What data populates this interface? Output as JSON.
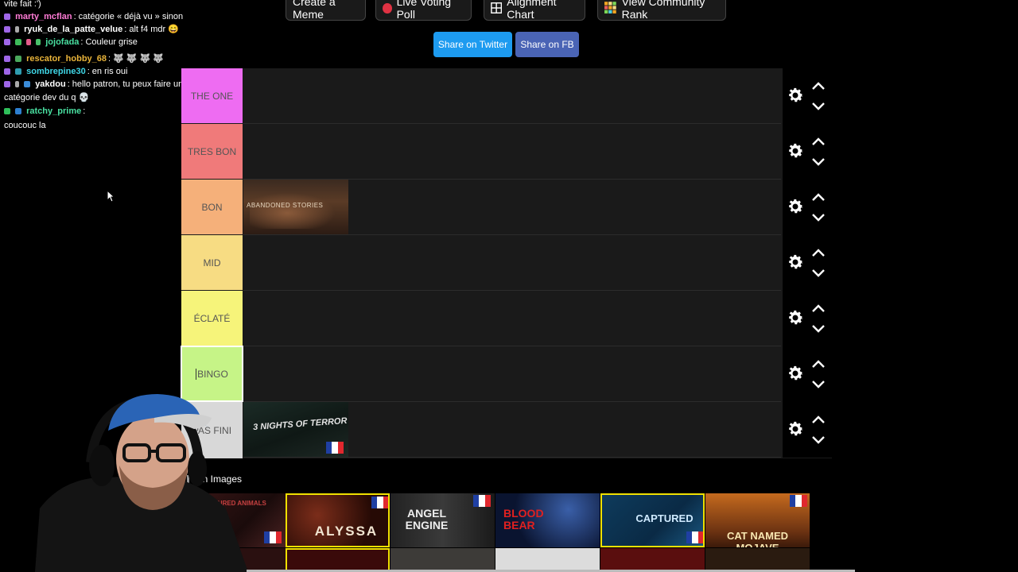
{
  "chat": {
    "messages": [
      {
        "user": "",
        "text": "vite fait :')",
        "user_color": "#ffffff"
      },
      {
        "user": "marty_mcflan",
        "text": "catégorie « déjà vu » sinon",
        "user_color": "#ff7bd6"
      },
      {
        "user": "ryuk_de_la_patte_velue",
        "text": "alt f4 mdr 😄",
        "user_color": "#ffffff"
      },
      {
        "user": "jojofada",
        "text": "Couleur grise",
        "user_color": "#49e0a1"
      },
      {
        "user": "rescator_hobby_68",
        "text": "🐺 🐺 🐺 🐺",
        "user_color": "#e9b43a"
      },
      {
        "user": "sombrepine30",
        "text": "en ris oui",
        "user_color": "#3fd6e6"
      },
      {
        "user": "yakdou",
        "text": "hello patron, tu peux faire une",
        "user_color": "#ffffff"
      },
      {
        "user": "",
        "text": "catégorie dev du q 💀",
        "user_color": "#ffffff"
      },
      {
        "user": "ratchy_prime",
        "text": "",
        "user_color": "#49e0a1"
      },
      {
        "user": "",
        "text": "coucouc la",
        "user_color": "#ffffff"
      }
    ]
  },
  "toolbar": {
    "create_meme": "Create a Meme",
    "live_voting": "Live Voting Poll",
    "alignment_chart": "Alignment Chart",
    "community_rank": "View Community Rank"
  },
  "share": {
    "twitter": "Share on Twitter",
    "facebook": "Share on FB",
    "twitter_color": "#1d9bf0",
    "facebook_color": "#4a64b5"
  },
  "tiers": [
    {
      "label": "THE ONE",
      "color": "#ee6cf2"
    },
    {
      "label": "TRES BON",
      "color": "#f07a7a"
    },
    {
      "label": "BON",
      "color": "#f5b07a"
    },
    {
      "label": "MID",
      "color": "#f7dc83"
    },
    {
      "label": "ÉCLATÉ",
      "color": "#f6f47a"
    },
    {
      "label": "BINGO",
      "color": "#c6f487"
    },
    {
      "label": "PAS FINI",
      "color": "#d8d8d8"
    }
  ],
  "tier_items": {
    "bon_item": "ABANDONED STORIES",
    "pas_fini_item": "3 NIGHTS OF TERROR"
  },
  "pin": {
    "label": "Pin Images"
  },
  "pool": [
    {
      "title": "TORTURED ANIMALS"
    },
    {
      "title": "ALYSSA"
    },
    {
      "title": "ANGEL ENGINE"
    },
    {
      "title": "BLOOD BEAR"
    },
    {
      "title": "CAPTURED"
    },
    {
      "title": "CAT NAMED MOJAVE"
    }
  ],
  "icons": {
    "gear": "gear-icon",
    "up": "chevron-up-icon",
    "down": "chevron-down-icon",
    "grid": "grid-icon",
    "rank": "rank-grid-icon",
    "record": "record-dot-icon",
    "cursor": "mouse-cursor-icon"
  }
}
